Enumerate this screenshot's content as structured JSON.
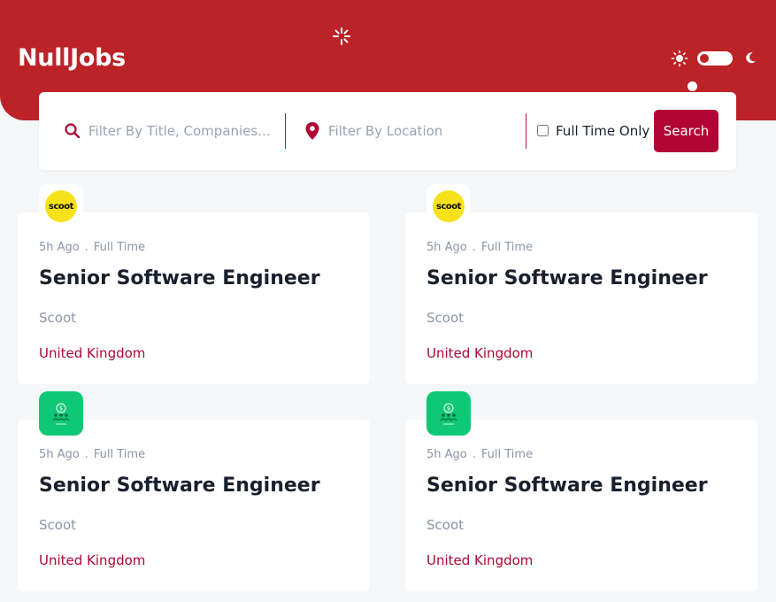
{
  "app": {
    "name": "NullJobs"
  },
  "search": {
    "title_placeholder": "Filter By Title, Companies...",
    "location_placeholder": "Filter By Location",
    "fulltime_label": "Full Time Only",
    "fulltime_checked": false,
    "button_label": "Search"
  },
  "theme": {
    "mode": "light",
    "accent": "#bb2328"
  },
  "jobs": [
    {
      "posted": "5h Ago",
      "type": "Full Time",
      "title": "Senior Software Engineer",
      "company": "Scoot",
      "location": "United Kingdom",
      "logo_text": "scoot",
      "logo_icon": "scoot-logo"
    },
    {
      "posted": "5h Ago",
      "type": "Full Time",
      "title": "Senior Software Engineer",
      "company": "Scoot",
      "location": "United Kingdom",
      "logo_text": "scoot",
      "logo_icon": "scoot-logo"
    },
    {
      "posted": "5h Ago",
      "type": "Full Time",
      "title": "Senior Software Engineer",
      "company": "Scoot",
      "location": "United Kingdom",
      "logo_icon": "money-people-logo"
    },
    {
      "posted": "5h Ago",
      "type": "Full Time",
      "title": "Senior Software Engineer",
      "company": "Scoot",
      "location": "United Kingdom",
      "logo_icon": "money-people-logo"
    }
  ]
}
